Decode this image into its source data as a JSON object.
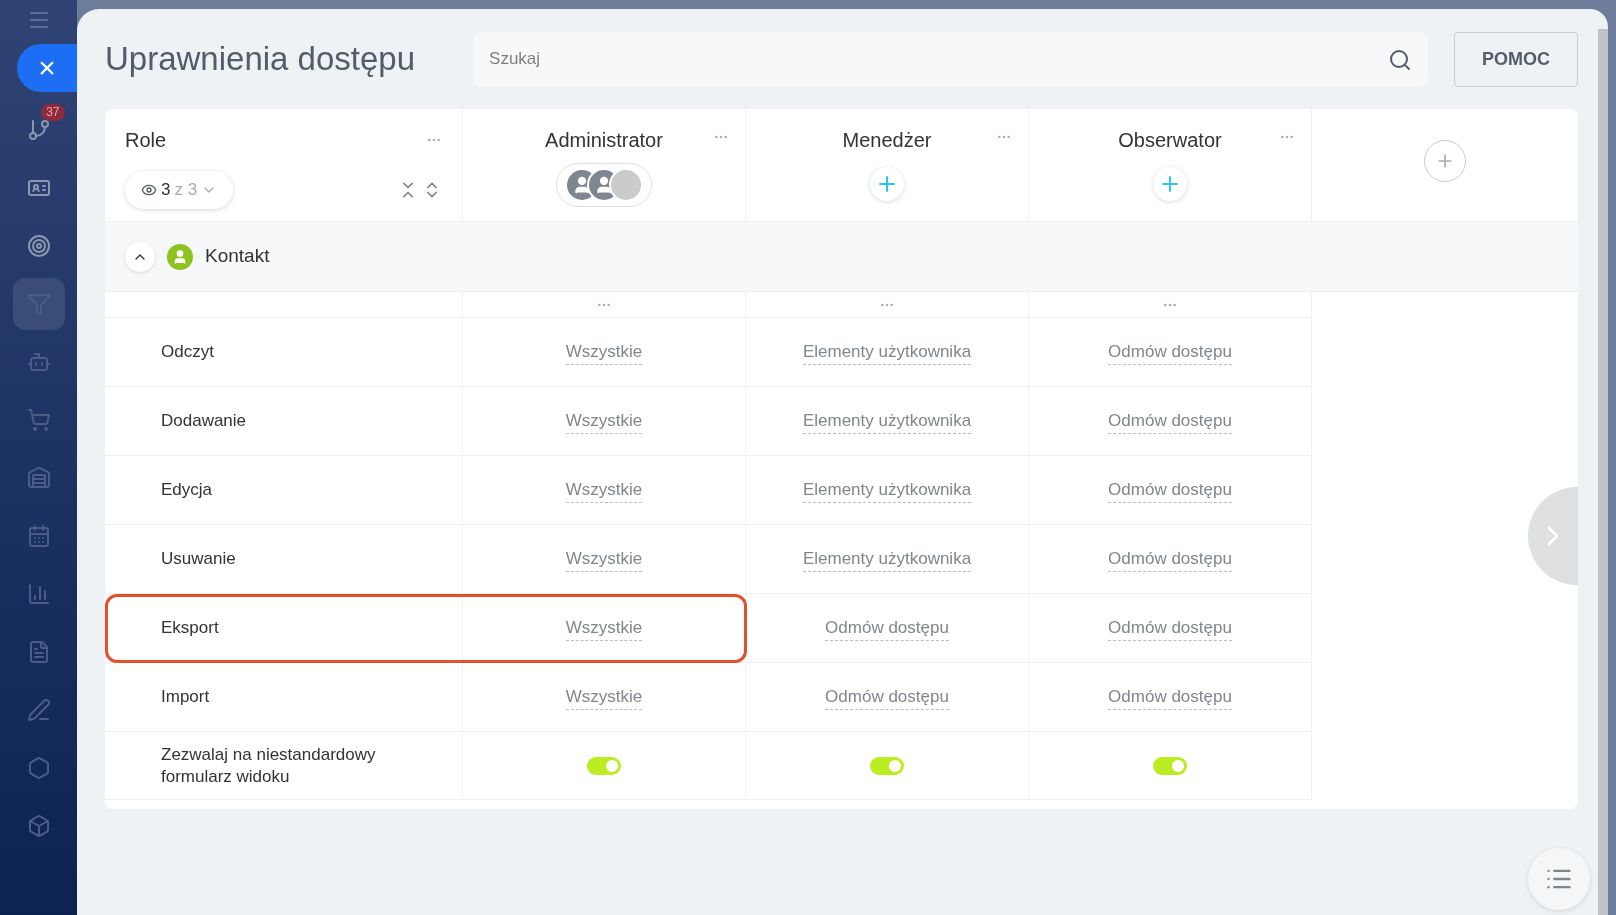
{
  "sidebar": {
    "close_label": "×",
    "items": [
      {
        "badge": "37",
        "selected": false
      },
      {
        "selected": false
      },
      {
        "selected": false
      },
      {
        "selected": true
      },
      {
        "selected": false
      },
      {
        "selected": false
      },
      {
        "selected": false
      },
      {
        "selected": false
      },
      {
        "selected": false
      },
      {
        "selected": false
      },
      {
        "selected": false
      },
      {
        "selected": false
      },
      {
        "selected": false
      }
    ]
  },
  "title": "Uprawnienia dostępu",
  "search": {
    "placeholder": "Szukaj"
  },
  "help_button": "POMOC",
  "table": {
    "role_header": "Role",
    "visible_count": "3",
    "total_label": "z 3",
    "roles": [
      {
        "name": "Administrator",
        "kind": "avatars"
      },
      {
        "name": "Menedżer",
        "kind": "add"
      },
      {
        "name": "Obserwator",
        "kind": "add"
      }
    ],
    "group": {
      "name": "Kontakt",
      "expanded": true
    },
    "rows": [
      {
        "label": "Odczyt",
        "highlighted": false,
        "cells": [
          {
            "kind": "select",
            "value": "Wszystkie"
          },
          {
            "kind": "select",
            "value": "Elementy użytkownika"
          },
          {
            "kind": "select",
            "value": "Odmów dostępu"
          }
        ]
      },
      {
        "label": "Dodawanie",
        "highlighted": false,
        "cells": [
          {
            "kind": "select",
            "value": "Wszystkie"
          },
          {
            "kind": "select",
            "value": "Elementy użytkownika"
          },
          {
            "kind": "select",
            "value": "Odmów dostępu"
          }
        ]
      },
      {
        "label": "Edycja",
        "highlighted": false,
        "cells": [
          {
            "kind": "select",
            "value": "Wszystkie"
          },
          {
            "kind": "select",
            "value": "Elementy użytkownika"
          },
          {
            "kind": "select",
            "value": "Odmów dostępu"
          }
        ]
      },
      {
        "label": "Usuwanie",
        "highlighted": false,
        "cells": [
          {
            "kind": "select",
            "value": "Wszystkie"
          },
          {
            "kind": "select",
            "value": "Elementy użytkownika"
          },
          {
            "kind": "select",
            "value": "Odmów dostępu"
          }
        ]
      },
      {
        "label": "Eksport",
        "highlighted": true,
        "cells": [
          {
            "kind": "select",
            "value": "Wszystkie"
          },
          {
            "kind": "select",
            "value": "Odmów dostępu"
          },
          {
            "kind": "select",
            "value": "Odmów dostępu"
          }
        ]
      },
      {
        "label": "Import",
        "highlighted": false,
        "cells": [
          {
            "kind": "select",
            "value": "Wszystkie"
          },
          {
            "kind": "select",
            "value": "Odmów dostępu"
          },
          {
            "kind": "select",
            "value": "Odmów dostępu"
          }
        ]
      },
      {
        "label": "Zezwalaj na niestandardowy formularz widoku",
        "highlighted": false,
        "cells": [
          {
            "kind": "toggle",
            "on": true
          },
          {
            "kind": "toggle",
            "on": true
          },
          {
            "kind": "toggle",
            "on": true
          }
        ]
      }
    ]
  }
}
